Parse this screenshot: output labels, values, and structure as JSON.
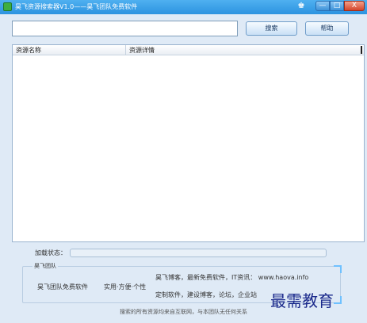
{
  "window": {
    "title": "昊飞资源搜索器V1.0——昊飞团队免费软件",
    "icons": {
      "app": "app-icon",
      "skin": "shirt-icon"
    },
    "controls": {
      "minimize": "—",
      "maximize": "□",
      "close": "X"
    }
  },
  "search": {
    "value": "",
    "placeholder": "",
    "button_label": "搜索",
    "help_label": "帮助"
  },
  "list": {
    "columns": [
      "资源名称",
      "资源详情"
    ],
    "rows": []
  },
  "status": {
    "label": "加载状态：",
    "progress": 0
  },
  "group": {
    "legend": "昊飞团队",
    "left_text": "昊飞团队免费软件",
    "mid_text": "实用·方便·个性",
    "line1": "昊飞博客，最新免费软件，IT资讯： www.haova.info",
    "line2": "定制软件，建设博客，论坛，企业站"
  },
  "footer": {
    "text": "搜索的所有资源均来自互联网，与本团队无任何关系"
  },
  "watermark": {
    "text": "最需教育"
  },
  "colors": {
    "titlebar": "#3aa0e8",
    "panel_bg": "#dfeaf6",
    "progress_fill": "#5fb0ef",
    "watermark": "#1b2a8c"
  }
}
